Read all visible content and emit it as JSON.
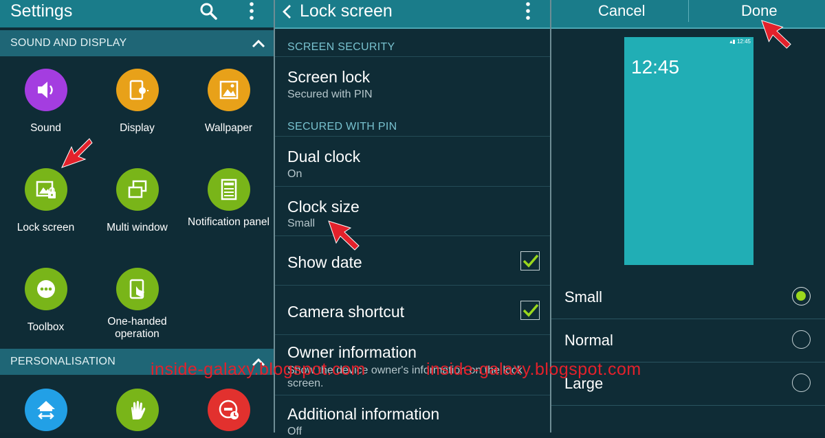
{
  "colors": {
    "header": "#1a7c8a",
    "accent": "#9ad71d",
    "sound": "#a43de0",
    "display": "#e8a119",
    "wallpaper": "#e8a119",
    "lock_screen": "#79b519",
    "multi_window": "#79b519",
    "notification_panel": "#79b519",
    "toolbox": "#79b519",
    "one_handed": "#79b519",
    "blue_tile": "#22a0e6",
    "hand_tile": "#79b519",
    "red_tile": "#e2312e"
  },
  "settings": {
    "title": "Settings",
    "section_sound_display": "SOUND AND DISPLAY",
    "section_personalisation": "PERSONALISATION",
    "tiles": [
      {
        "label": "Sound",
        "icon": "speaker-icon"
      },
      {
        "label": "Display",
        "icon": "display-icon"
      },
      {
        "label": "Wallpaper",
        "icon": "wallpaper-icon"
      },
      {
        "label": "Lock screen",
        "icon": "lock-screen-icon"
      },
      {
        "label": "Multi window",
        "icon": "multi-window-icon"
      },
      {
        "label": "Notification panel",
        "icon": "notification-panel-icon"
      },
      {
        "label": "Toolbox",
        "icon": "toolbox-icon"
      },
      {
        "label": "One-handed operation",
        "icon": "one-handed-icon"
      }
    ]
  },
  "lock_screen": {
    "title": "Lock screen",
    "section_screen_security": "SCREEN SECURITY",
    "section_secured_with_pin": "SECURED WITH PIN",
    "rows": [
      {
        "title": "Screen lock",
        "sub": "Secured with PIN"
      },
      {
        "title": "Dual clock",
        "sub": "On"
      },
      {
        "title": "Clock size",
        "sub": "Small"
      },
      {
        "title": "Show date",
        "checked": true
      },
      {
        "title": "Camera shortcut",
        "checked": true
      },
      {
        "title": "Owner information",
        "sub": "Show the device owner's information on the lock screen."
      },
      {
        "title": "Additional information",
        "sub": "Off"
      }
    ]
  },
  "clock_size": {
    "cancel": "Cancel",
    "done": "Done",
    "preview_time": "12:45",
    "preview_status_time": "12:45",
    "options": [
      {
        "label": "Small",
        "selected": true
      },
      {
        "label": "Normal",
        "selected": false
      },
      {
        "label": "Large",
        "selected": false
      }
    ]
  },
  "watermark": {
    "left": "inside-galaxy.blogspot.com",
    "right": "inside-galaxy.blogspot.com"
  }
}
